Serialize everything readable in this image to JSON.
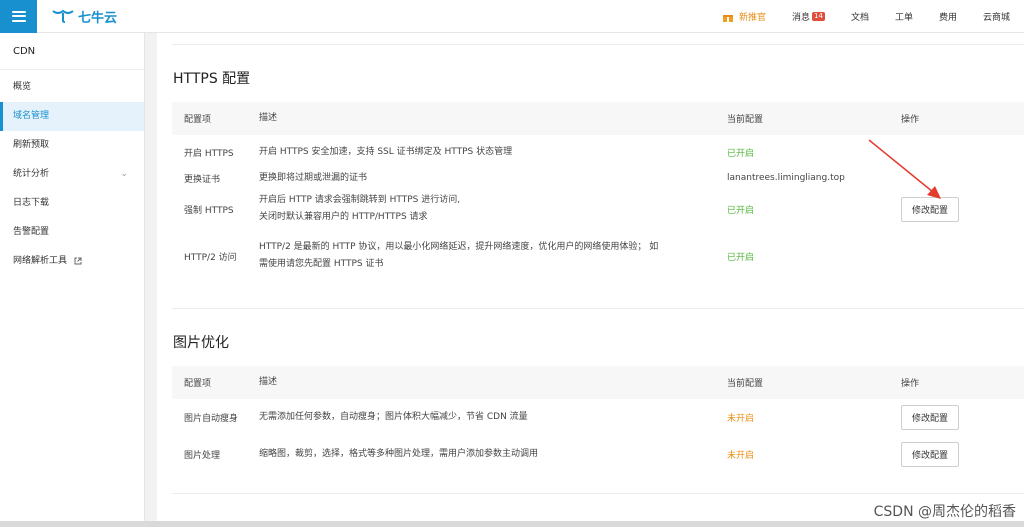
{
  "topbar": {
    "logo_text": "七牛云",
    "items": [
      {
        "label": "新推官",
        "type": "promo"
      },
      {
        "label": "消息",
        "badge": "14"
      },
      {
        "label": "文档"
      },
      {
        "label": "工单"
      },
      {
        "label": "费用"
      },
      {
        "label": "云商城"
      }
    ]
  },
  "sidebar": {
    "header": "CDN",
    "items": [
      {
        "label": "概览"
      },
      {
        "label": "域名管理",
        "active": true
      },
      {
        "label": "刷新预取"
      },
      {
        "label": "统计分析",
        "chevron": "⌄"
      },
      {
        "label": "日志下载"
      },
      {
        "label": "告警配置"
      },
      {
        "label": "网络解析工具"
      }
    ]
  },
  "https": {
    "title": "HTTPS 配置",
    "headers": [
      "配置项",
      "描述",
      "当前配置",
      "操作"
    ],
    "rows": [
      {
        "name": "开启 HTTPS",
        "desc": "开启 HTTPS 安全加速，支持 SSL 证书绑定及 HTTPS 状态管理",
        "value": "已开启",
        "status": "on"
      },
      {
        "name": "更换证书",
        "desc": "更换即将过期或泄漏的证书",
        "value": "lanantrees.limingliang.top",
        "status": "plain"
      },
      {
        "name": "强制 HTTPS",
        "desc": "开启后 HTTP 请求会强制跳转到 HTTPS 进行访问,",
        "desc2": "关闭时默认兼容用户的 HTTP/HTTPS 请求",
        "value": "已开启",
        "status": "on"
      },
      {
        "name": "HTTP/2 访问",
        "desc": "HTTP/2 是最新的 HTTP 协议，用以最小化网络延迟，提升网络速度，优化用户的网络使用体验； 如",
        "desc2": "需使用请您先配置 HTTPS 证书",
        "value": "已开启",
        "status": "on"
      }
    ],
    "action": "修改配置"
  },
  "image": {
    "title": "图片优化",
    "headers": [
      "配置项",
      "描述",
      "当前配置",
      "操作"
    ],
    "rows": [
      {
        "name": "图片自动瘦身",
        "desc": "无需添加任何参数，自动瘦身；图片体积大幅减少，节省 CDN 流量",
        "value": "未开启",
        "status": "off",
        "action": "修改配置"
      },
      {
        "name": "图片处理",
        "desc": "缩略图，裁剪，选择，格式等多种图片处理，需用户添加参数主动调用",
        "value": "未开启",
        "status": "off",
        "action": "修改配置"
      }
    ]
  },
  "watermark": "CSDN @周杰伦的稻香",
  "colors": {
    "brand": "#1890d0",
    "on": "#52b83b",
    "off": "#e88d14",
    "arrow": "#e33b2e"
  }
}
